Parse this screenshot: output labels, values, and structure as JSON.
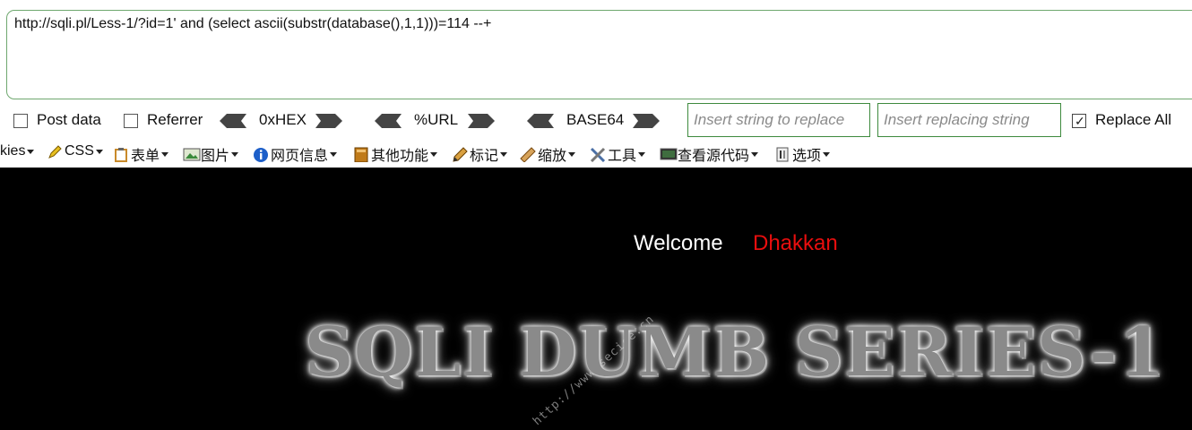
{
  "url_box": {
    "text": "http://sqli.pl/Less-1/?id=1' and (select ascii(substr(database(),1,1)))=114 --+"
  },
  "options": {
    "post_data_label": "Post data",
    "referrer_label": "Referrer",
    "hex_label": "0xHEX",
    "url_label": "%URL",
    "base64_label": "BASE64",
    "insert_replace_placeholder": "Insert string to replace",
    "insert_replacing_placeholder": "Insert replacing string",
    "replace_all_label": "Replace All",
    "replace_all_checked": true
  },
  "toolbar": {
    "items": [
      {
        "label": "kies",
        "icon": "none"
      },
      {
        "label": "CSS",
        "icon": "pencil-icon"
      },
      {
        "label": "表单",
        "icon": "clipboard-icon"
      },
      {
        "label": "图片",
        "icon": "image-icon"
      },
      {
        "label": "网页信息",
        "icon": "info-icon"
      },
      {
        "label": "其他功能",
        "icon": "book-icon"
      },
      {
        "label": "标记",
        "icon": "pen-icon"
      },
      {
        "label": "缩放",
        "icon": "ruler-icon"
      },
      {
        "label": "工具",
        "icon": "tools-icon"
      },
      {
        "label": "查看源代码",
        "icon": "monitor-icon"
      },
      {
        "label": "选项",
        "icon": "options-icon"
      }
    ]
  },
  "page": {
    "watermark": "http://www.secice.cn",
    "welcome": "Welcome",
    "username": "Dhakkan",
    "banner": "SQLI DUMB SERIES-1"
  },
  "colors": {
    "accent_green": "#3e8a3e",
    "username_red": "#e80e0e",
    "page_bg": "#000000"
  }
}
